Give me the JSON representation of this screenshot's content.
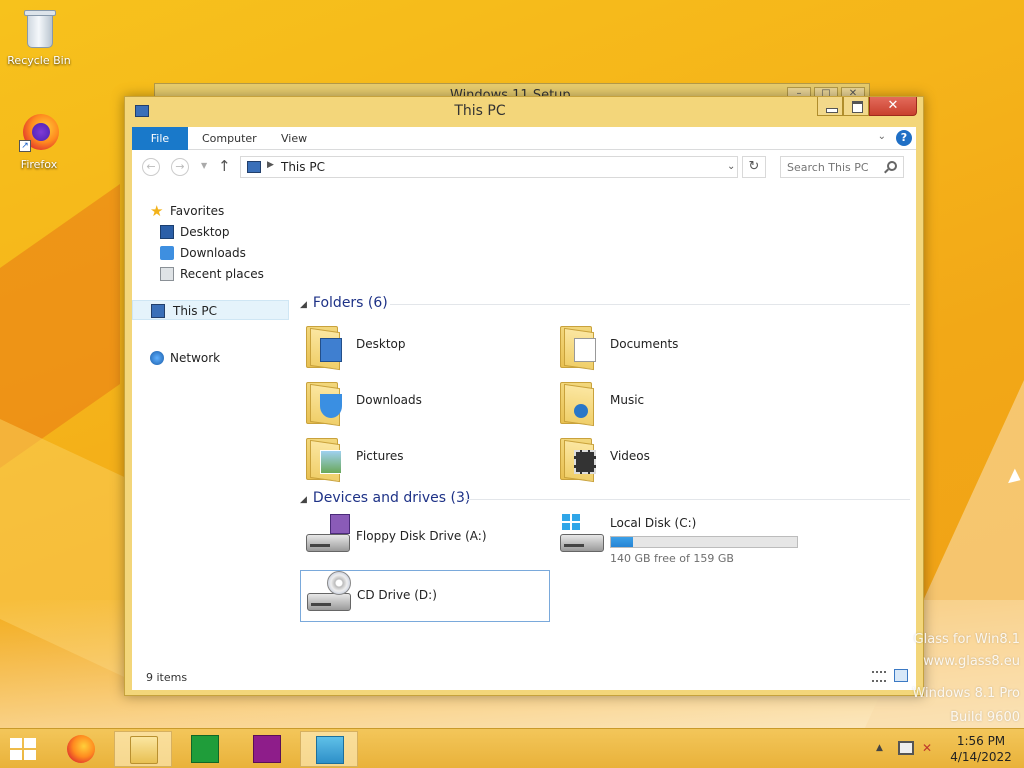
{
  "desktop": {
    "icons": [
      {
        "label": "Recycle Bin"
      },
      {
        "label": "Firefox"
      }
    ],
    "watermark": [
      "Glass for Win8.1",
      "www.glass8.eu",
      "Windows 8.1 Pro",
      "Build 9600"
    ]
  },
  "background_window": {
    "title": "Windows 11 Setup"
  },
  "window": {
    "title": "This PC",
    "close_glyph": "✕",
    "ribbon": {
      "tabs": [
        "File",
        "Computer",
        "View"
      ],
      "help": "?"
    },
    "address": {
      "path": "This PC",
      "search_placeholder": "Search This PC"
    },
    "sidebar": {
      "favorites": "Favorites",
      "items": [
        "Desktop",
        "Downloads",
        "Recent places"
      ],
      "this_pc": "This PC",
      "network": "Network"
    },
    "groups": {
      "folders_header": "Folders (6)",
      "folders": [
        "Desktop",
        "Documents",
        "Downloads",
        "Music",
        "Pictures",
        "Videos"
      ],
      "devices_header": "Devices and drives (3)",
      "devices": {
        "floppy": "Floppy Disk Drive (A:)",
        "local": "Local Disk (C:)",
        "local_free": "140 GB free of 159 GB",
        "local_used_fraction": 0.12,
        "cd": "CD Drive (D:)"
      }
    },
    "status": "9 items"
  },
  "taskbar": {
    "time": "1:56 PM",
    "date": "4/14/2022"
  }
}
